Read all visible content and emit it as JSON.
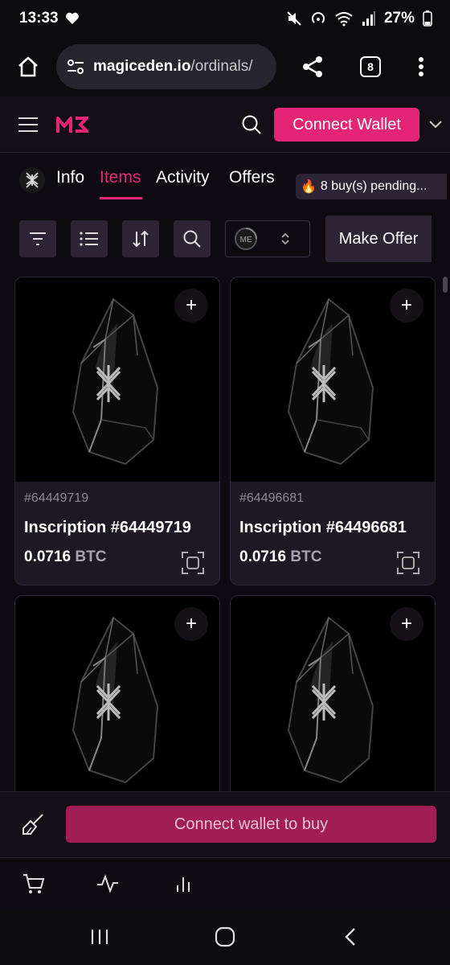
{
  "status_bar": {
    "time": "13:33",
    "battery": "27%"
  },
  "browser": {
    "url_domain": "magiceden.io",
    "url_path": "/ordinals/",
    "tab_count": "8"
  },
  "header": {
    "connect_label": "Connect Wallet"
  },
  "tabs": [
    {
      "label": "Info"
    },
    {
      "label": "Items"
    },
    {
      "label": "Activity"
    },
    {
      "label": "Offers"
    }
  ],
  "pending": {
    "emoji": "🔥",
    "label": "8 buy(s) pending..."
  },
  "toolbar": {
    "make_offer_label": "Make Offer"
  },
  "items": [
    {
      "id": "#64449719",
      "title": "Inscription #64449719",
      "price": "0.0716",
      "unit": "BTC"
    },
    {
      "id": "#64496681",
      "title": "Inscription #64496681",
      "price": "0.0716",
      "unit": "BTC"
    },
    {
      "id": "",
      "title": "",
      "price": "",
      "unit": ""
    },
    {
      "id": "",
      "title": "",
      "price": "",
      "unit": ""
    }
  ],
  "buy_bar": {
    "button_label": "Connect wallet to buy"
  },
  "colors": {
    "accent": "#e42575",
    "buy_button": "#a11d55",
    "card_bg": "#1e1824",
    "button_bg": "#2d2535"
  },
  "icons": [
    "home-icon",
    "site-settings-icon",
    "share-icon",
    "more-vert-icon",
    "hamburger-icon",
    "search-icon",
    "chevron-down-icon",
    "filter-icon",
    "list-icon",
    "sort-icon",
    "magic-eden-icon",
    "plus-icon",
    "scan-icon",
    "broom-icon",
    "cart-icon",
    "activity-icon",
    "bar-chart-icon"
  ]
}
